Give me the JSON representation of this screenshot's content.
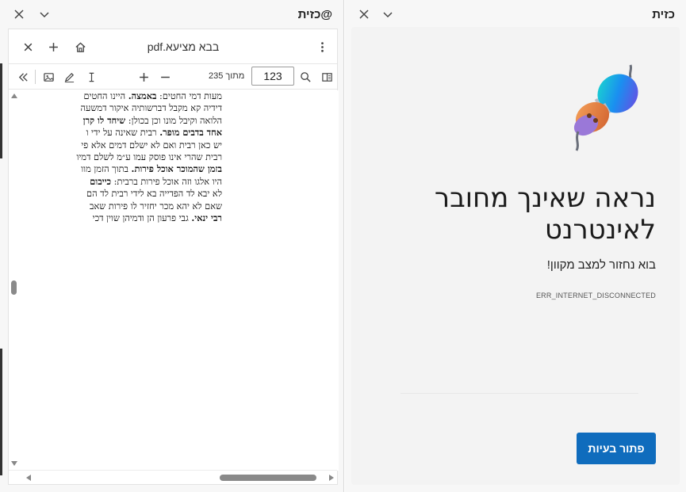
{
  "left_pane": {
    "title": "@כזית",
    "viewer": {
      "tab_title": "בבא מציעא.pdf",
      "toolbar": {
        "page_number": "123",
        "page_total": "מתוך 235"
      },
      "page_text": [
        "מעות דמי החטים: <b>באמצה.</b> היינו החטים",
        "דידיה קא מקבל דברשותיה איקור דמשעה",
        "הלואה וקיבל מונו וכן בכולן: <b>שיחד לו קרן</b>",
        "<b>אחד בדבים מופר.</b> רבית שאינה על ידי ו",
        "יש כאן רבית ואם לא ישלם דמים אלא פי",
        "רבית שהרי אינו פוסק עמו ע״מ לשלם דמיו",
        "<b>בזמן שהמוכר אוכל פירות.</b> בתוך הזמן מוו",
        "היו אלגו וזה אוכל פירות ברבית: <b>כייבום</b>",
        "לא יבא לד הפדייה בא לידי רבית לד הם",
        "שאם לא יהא מכר יחזיר לו פירות שאב",
        "<b>רבי ינאי.</b> גבי פרעון הן ודמיהן שוין דכי"
      ]
    }
  },
  "right_pane": {
    "title": "כזית",
    "offline": {
      "heading": "נראה שאינך מחובר לאינטרנט",
      "subheading": "בוא נחזור למצב מקוון!",
      "error_code": "ERR_INTERNET_DISCONNECTED",
      "fix_button": "פתור בעיות"
    }
  },
  "colors": {
    "accent": "#0f6cbd",
    "pane_bg": "#f7f7f7"
  }
}
